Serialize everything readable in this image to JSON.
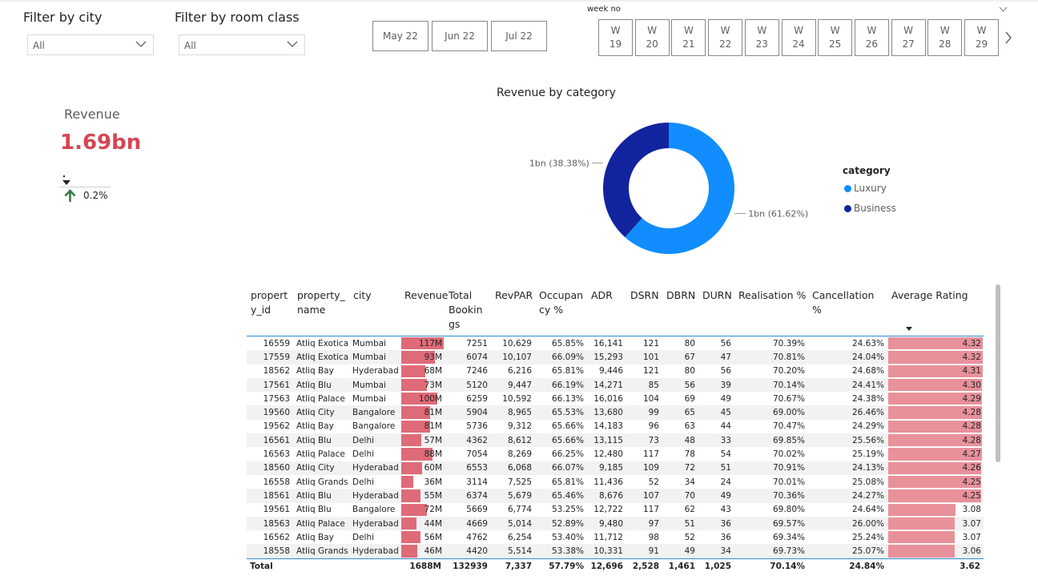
{
  "filters": {
    "city": {
      "title": "Filter by city",
      "value": "All"
    },
    "room_class": {
      "title": "Filter by room class",
      "value": "All"
    }
  },
  "months": [
    "May 22",
    "Jun 22",
    "Jul 22"
  ],
  "week_slicer": {
    "label": "week no",
    "weeks": [
      {
        "w": "W",
        "n": "19"
      },
      {
        "w": "W",
        "n": "20"
      },
      {
        "w": "W",
        "n": "21"
      },
      {
        "w": "W",
        "n": "22"
      },
      {
        "w": "W",
        "n": "23"
      },
      {
        "w": "W",
        "n": "24"
      },
      {
        "w": "W",
        "n": "25"
      },
      {
        "w": "W",
        "n": "26"
      },
      {
        "w": "W",
        "n": "27"
      },
      {
        "w": "W",
        "n": "28"
      },
      {
        "w": "W",
        "n": "29"
      }
    ]
  },
  "kpi": {
    "label": "Revenue",
    "value": "1.69bn",
    "change": "0.2%",
    "value_color": "#d64554",
    "arrow_color": "#3a7a4a"
  },
  "chart_data": {
    "type": "pie",
    "title": "Revenue by category",
    "legend_title": "category",
    "slices": [
      {
        "name": "Luxury",
        "value": 61.62,
        "label": "1bn (61.62%)",
        "color": "#118dff"
      },
      {
        "name": "Business",
        "value": 38.38,
        "label": "1bn (38.38%)",
        "color": "#12239e"
      }
    ],
    "donut": true,
    "legend_position": "right"
  },
  "table": {
    "headers": [
      "propert y_id",
      "property_ name",
      "city",
      "Revenue",
      "Total Bookin gs",
      "RevPAR",
      "Occupan cy %",
      "ADR",
      "DSRN",
      "DBRN",
      "DURN",
      "Realisation %",
      "Cancellation %",
      "Average Rating"
    ],
    "rows": [
      {
        "id": "16559",
        "name": "Atliq Exotica",
        "city": "Mumbai",
        "revenue": "117M",
        "rev_m": 117,
        "bookings": "7251",
        "revpar": "10,629",
        "occ": "65.85%",
        "adr": "16,141",
        "dsrn": "121",
        "dbrn": "80",
        "durn": "56",
        "real": "70.39%",
        "canc": "24.63%",
        "rating": "4.32",
        "rating_n": 4.32
      },
      {
        "id": "17559",
        "name": "Atliq Exotica",
        "city": "Mumbai",
        "revenue": "93M",
        "rev_m": 93,
        "bookings": "6074",
        "revpar": "10,107",
        "occ": "66.09%",
        "adr": "15,293",
        "dsrn": "101",
        "dbrn": "67",
        "durn": "47",
        "real": "70.81%",
        "canc": "24.04%",
        "rating": "4.32",
        "rating_n": 4.32
      },
      {
        "id": "18562",
        "name": "Atliq Bay",
        "city": "Hyderabad",
        "revenue": "68M",
        "rev_m": 68,
        "bookings": "7246",
        "revpar": "6,216",
        "occ": "65.81%",
        "adr": "9,446",
        "dsrn": "121",
        "dbrn": "80",
        "durn": "56",
        "real": "70.20%",
        "canc": "24.68%",
        "rating": "4.31",
        "rating_n": 4.31
      },
      {
        "id": "17561",
        "name": "Atliq Blu",
        "city": "Mumbai",
        "revenue": "73M",
        "rev_m": 73,
        "bookings": "5120",
        "revpar": "9,447",
        "occ": "66.19%",
        "adr": "14,271",
        "dsrn": "85",
        "dbrn": "56",
        "durn": "39",
        "real": "70.14%",
        "canc": "24.41%",
        "rating": "4.30",
        "rating_n": 4.3
      },
      {
        "id": "17563",
        "name": "Atliq Palace",
        "city": "Mumbai",
        "revenue": "100M",
        "rev_m": 100,
        "bookings": "6259",
        "revpar": "10,592",
        "occ": "66.13%",
        "adr": "16,016",
        "dsrn": "104",
        "dbrn": "69",
        "durn": "49",
        "real": "70.67%",
        "canc": "24.38%",
        "rating": "4.29",
        "rating_n": 4.29
      },
      {
        "id": "19560",
        "name": "Atliq City",
        "city": "Bangalore",
        "revenue": "81M",
        "rev_m": 81,
        "bookings": "5904",
        "revpar": "8,965",
        "occ": "65.53%",
        "adr": "13,680",
        "dsrn": "99",
        "dbrn": "65",
        "durn": "45",
        "real": "69.00%",
        "canc": "26.46%",
        "rating": "4.28",
        "rating_n": 4.28
      },
      {
        "id": "19562",
        "name": "Atliq Bay",
        "city": "Bangalore",
        "revenue": "81M",
        "rev_m": 81,
        "bookings": "5736",
        "revpar": "9,312",
        "occ": "65.66%",
        "adr": "14,183",
        "dsrn": "96",
        "dbrn": "63",
        "durn": "44",
        "real": "70.47%",
        "canc": "24.29%",
        "rating": "4.28",
        "rating_n": 4.28
      },
      {
        "id": "16561",
        "name": "Atliq Blu",
        "city": "Delhi",
        "revenue": "57M",
        "rev_m": 57,
        "bookings": "4362",
        "revpar": "8,612",
        "occ": "65.66%",
        "adr": "13,115",
        "dsrn": "73",
        "dbrn": "48",
        "durn": "33",
        "real": "69.85%",
        "canc": "25.56%",
        "rating": "4.28",
        "rating_n": 4.28
      },
      {
        "id": "16563",
        "name": "Atliq Palace",
        "city": "Delhi",
        "revenue": "88M",
        "rev_m": 88,
        "bookings": "7054",
        "revpar": "8,269",
        "occ": "66.25%",
        "adr": "12,480",
        "dsrn": "117",
        "dbrn": "78",
        "durn": "54",
        "real": "70.02%",
        "canc": "25.19%",
        "rating": "4.27",
        "rating_n": 4.27
      },
      {
        "id": "18560",
        "name": "Atliq City",
        "city": "Hyderabad",
        "revenue": "60M",
        "rev_m": 60,
        "bookings": "6553",
        "revpar": "6,068",
        "occ": "66.07%",
        "adr": "9,185",
        "dsrn": "109",
        "dbrn": "72",
        "durn": "51",
        "real": "70.91%",
        "canc": "24.13%",
        "rating": "4.26",
        "rating_n": 4.26
      },
      {
        "id": "16558",
        "name": "Atliq Grands",
        "city": "Delhi",
        "revenue": "36M",
        "rev_m": 36,
        "bookings": "3114",
        "revpar": "7,525",
        "occ": "65.81%",
        "adr": "11,436",
        "dsrn": "52",
        "dbrn": "34",
        "durn": "24",
        "real": "70.01%",
        "canc": "25.08%",
        "rating": "4.25",
        "rating_n": 4.25
      },
      {
        "id": "18561",
        "name": "Atliq Blu",
        "city": "Hyderabad",
        "revenue": "55M",
        "rev_m": 55,
        "bookings": "6374",
        "revpar": "5,679",
        "occ": "65.46%",
        "adr": "8,676",
        "dsrn": "107",
        "dbrn": "70",
        "durn": "49",
        "real": "70.36%",
        "canc": "24.27%",
        "rating": "4.25",
        "rating_n": 4.25
      },
      {
        "id": "19561",
        "name": "Atliq Blu",
        "city": "Bangalore",
        "revenue": "72M",
        "rev_m": 72,
        "bookings": "5669",
        "revpar": "6,774",
        "occ": "53.25%",
        "adr": "12,722",
        "dsrn": "117",
        "dbrn": "62",
        "durn": "43",
        "real": "69.80%",
        "canc": "24.64%",
        "rating": "3.08",
        "rating_n": 3.08
      },
      {
        "id": "18563",
        "name": "Atliq Palace",
        "city": "Hyderabad",
        "revenue": "44M",
        "rev_m": 44,
        "bookings": "4669",
        "revpar": "5,014",
        "occ": "52.89%",
        "adr": "9,480",
        "dsrn": "97",
        "dbrn": "51",
        "durn": "36",
        "real": "69.57%",
        "canc": "26.00%",
        "rating": "3.07",
        "rating_n": 3.07
      },
      {
        "id": "16562",
        "name": "Atliq Bay",
        "city": "Delhi",
        "revenue": "56M",
        "rev_m": 56,
        "bookings": "4762",
        "revpar": "6,254",
        "occ": "53.40%",
        "adr": "11,712",
        "dsrn": "98",
        "dbrn": "52",
        "durn": "36",
        "real": "69.34%",
        "canc": "25.24%",
        "rating": "3.07",
        "rating_n": 3.07
      },
      {
        "id": "18558",
        "name": "Atliq Grands",
        "city": "Hyderabad",
        "revenue": "46M",
        "rev_m": 46,
        "bookings": "4420",
        "revpar": "5,514",
        "occ": "53.38%",
        "adr": "10,331",
        "dsrn": "91",
        "dbrn": "49",
        "durn": "34",
        "real": "69.73%",
        "canc": "25.07%",
        "rating": "3.06",
        "rating_n": 3.06
      }
    ],
    "total": {
      "label": "Total",
      "revenue": "1688M",
      "bookings": "132939",
      "revpar": "7,337",
      "occ": "57.79%",
      "adr": "12,696",
      "dsrn": "2,528",
      "dbrn": "1,461",
      "durn": "1,025",
      "real": "70.14%",
      "canc": "24.84%",
      "rating": "3.62"
    },
    "max_revenue_m": 117,
    "max_rating": 4.32
  }
}
